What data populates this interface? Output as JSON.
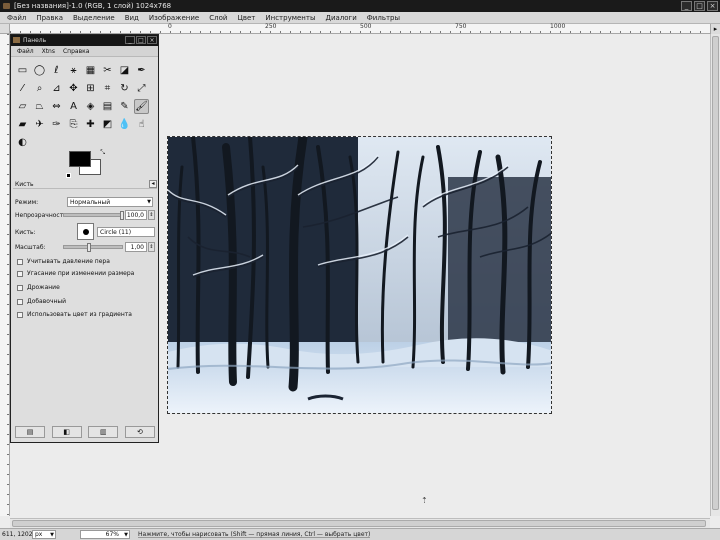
{
  "window": {
    "title": "[Без названия]-1.0 (RGB, 1 слой) 1024x768",
    "controls": [
      "_",
      "□",
      "×"
    ]
  },
  "menubar": [
    "Файл",
    "Правка",
    "Выделение",
    "Вид",
    "Изображение",
    "Слой",
    "Цвет",
    "Инструменты",
    "Диалоги",
    "Фильтры"
  ],
  "ruler": {
    "labels": [
      "0",
      "250",
      "500",
      "750",
      "1000"
    ]
  },
  "toolbox": {
    "title": "Панель",
    "controls": [
      "_",
      "□",
      "×"
    ],
    "menus": [
      "Файл",
      "Xtns",
      "Справка"
    ],
    "tools": [
      {
        "icon": "rect-select-icon",
        "glyph": "▭"
      },
      {
        "icon": "ellipse-select-icon",
        "glyph": "◯"
      },
      {
        "icon": "free-select-icon",
        "glyph": "ℓ"
      },
      {
        "icon": "fuzzy-select-icon",
        "glyph": "⚹"
      },
      {
        "icon": "color-select-icon",
        "glyph": "▦"
      },
      {
        "icon": "scissors-icon",
        "glyph": "✂"
      },
      {
        "icon": "foreground-select-icon",
        "glyph": "◪"
      },
      {
        "icon": "paths-icon",
        "glyph": "✒"
      },
      {
        "icon": "color-picker-icon",
        "glyph": "⁄"
      },
      {
        "icon": "zoom-icon",
        "glyph": "⌕"
      },
      {
        "icon": "measure-icon",
        "glyph": "⊿"
      },
      {
        "icon": "move-icon",
        "glyph": "✥"
      },
      {
        "icon": "align-icon",
        "glyph": "⊞"
      },
      {
        "icon": "crop-icon",
        "glyph": "⌗"
      },
      {
        "icon": "rotate-icon",
        "glyph": "↻"
      },
      {
        "icon": "scale-icon",
        "glyph": "⤢"
      },
      {
        "icon": "shear-icon",
        "glyph": "▱"
      },
      {
        "icon": "perspective-icon",
        "glyph": "⏢"
      },
      {
        "icon": "flip-icon",
        "glyph": "⇔"
      },
      {
        "icon": "text-icon",
        "glyph": "A"
      },
      {
        "icon": "bucket-fill-icon",
        "glyph": "◈"
      },
      {
        "icon": "blend-icon",
        "glyph": "▤"
      },
      {
        "icon": "pencil-icon",
        "glyph": "✎"
      },
      {
        "icon": "paintbrush-icon",
        "glyph": "🖌"
      },
      {
        "icon": "eraser-icon",
        "glyph": "▰"
      },
      {
        "icon": "airbrush-icon",
        "glyph": "✈"
      },
      {
        "icon": "ink-icon",
        "glyph": "✑"
      },
      {
        "icon": "clone-icon",
        "glyph": "⎘"
      },
      {
        "icon": "heal-icon",
        "glyph": "✚"
      },
      {
        "icon": "perspective-clone-icon",
        "glyph": "◩"
      },
      {
        "icon": "blur-icon",
        "glyph": "💧"
      },
      {
        "icon": "smudge-icon",
        "glyph": "☝"
      },
      {
        "icon": "dodge-burn-icon",
        "glyph": "◐"
      }
    ],
    "active_tool_index": 23,
    "colors": {
      "fg": "#000000",
      "bg": "#ffffff"
    },
    "options": {
      "header": "Кисть",
      "mode_label": "Режим:",
      "mode_value": "Нормальный",
      "opacity_label": "Непрозрачность:",
      "opacity_value": "100,0",
      "opacity_fraction": 1.0,
      "brush_label": "Кисть:",
      "brush_value": "Circle (11)",
      "scale_label": "Масштаб:",
      "scale_value": "1,00",
      "scale_fraction": 0.45,
      "checks": [
        "Учитывать давление пера",
        "Угасание при изменении размера",
        "Дрожание",
        "Добавочный",
        "Использовать цвет из градиента"
      ]
    },
    "bottom_buttons": [
      "▤",
      "◧",
      "▥",
      "⟲"
    ]
  },
  "statusbar": {
    "coords": "611, 1202",
    "unit": "px",
    "zoom": "67%",
    "message": "Нажмите, чтобы нарисовать (Shift — прямая линия, Ctrl — выбрать цвет)"
  }
}
